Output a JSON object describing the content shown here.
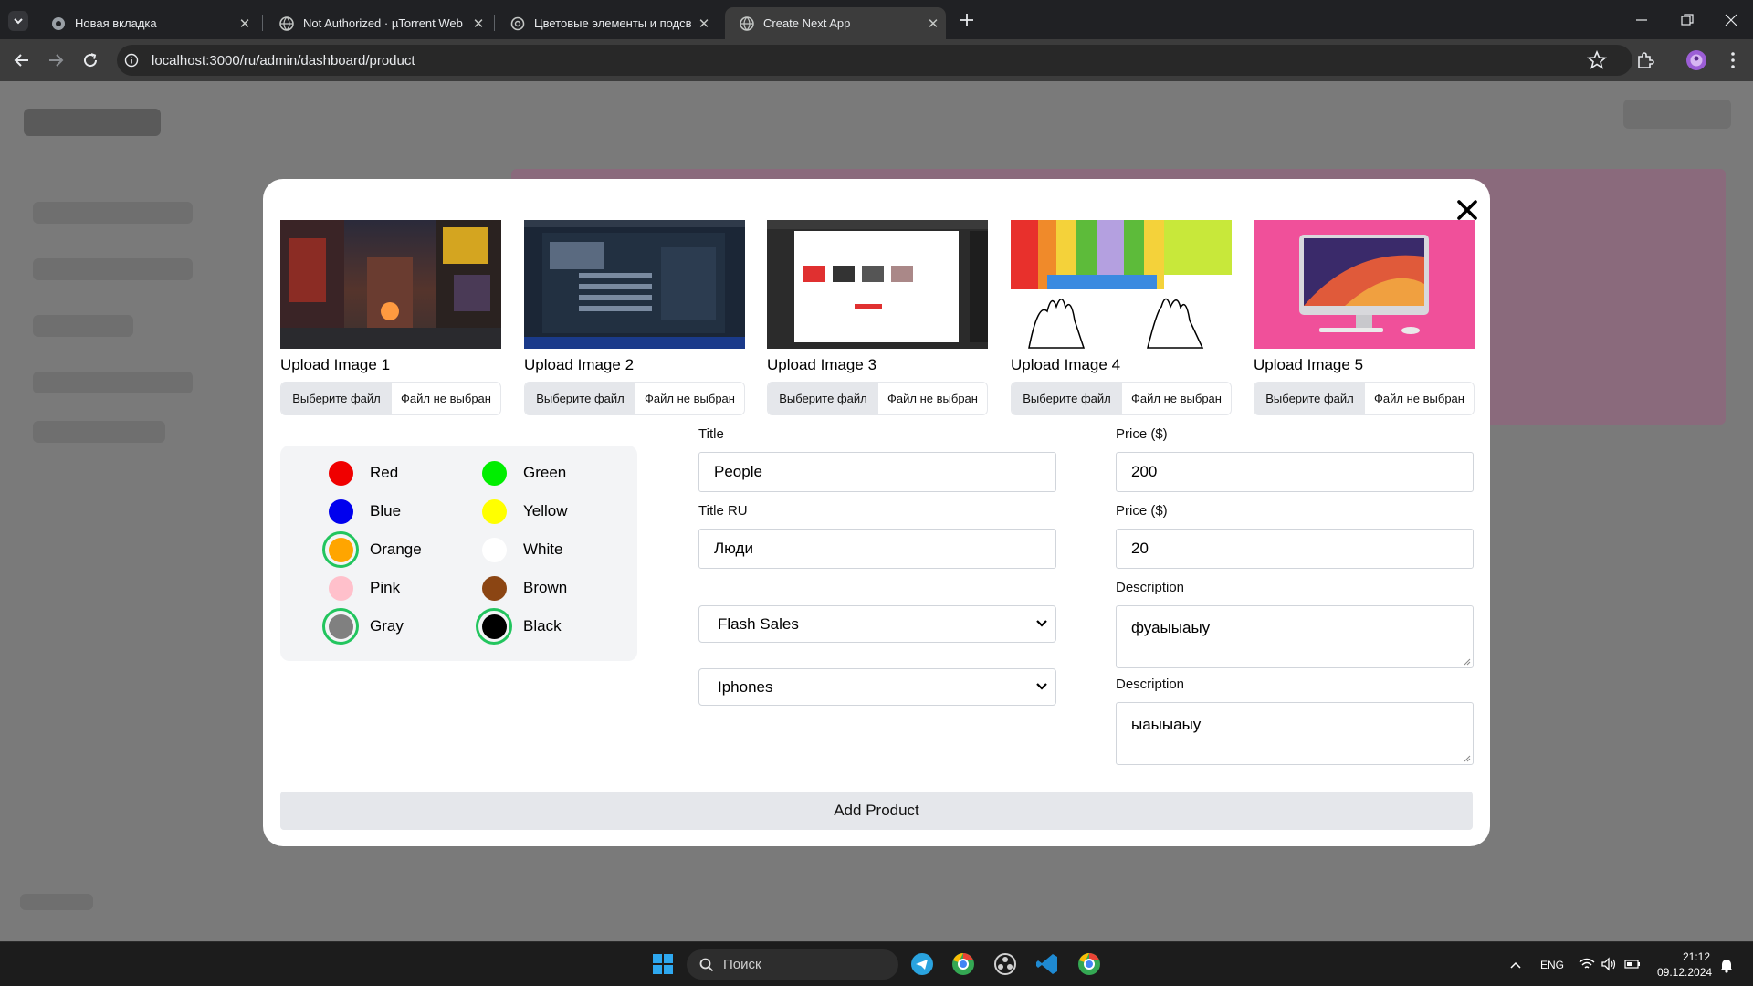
{
  "browser": {
    "tabs": [
      {
        "label": "Новая вкладка",
        "active": false
      },
      {
        "label": "Not Authorized · µTorrent Web",
        "active": false
      },
      {
        "label": "Цветовые элементы и подсвет",
        "active": false
      },
      {
        "label": "Create Next App",
        "active": true
      }
    ],
    "new_tab_icon": "plus-icon",
    "url": "localhost:3000/ru/admin/dashboard/product"
  },
  "modal": {
    "images": [
      {
        "label": "Upload Image 1",
        "button": "Выберите файл",
        "status": "Файл не выбран",
        "thumb": "city-street"
      },
      {
        "label": "Upload Image 2",
        "button": "Выберите файл",
        "status": "Файл не выбран",
        "thumb": "dark-screenshot"
      },
      {
        "label": "Upload Image 3",
        "button": "Выберите файл",
        "status": "Файл не выбран",
        "thumb": "shop-screenshot"
      },
      {
        "label": "Upload Image 4",
        "button": "Выберите файл",
        "status": "Файл не выбран",
        "thumb": "keyboard-fingers"
      },
      {
        "label": "Upload Image 5",
        "button": "Выберите файл",
        "status": "Файл не выбран",
        "thumb": "imac-pink"
      }
    ],
    "colors": [
      {
        "name": "Red",
        "hex": "#f00000",
        "selected": false
      },
      {
        "name": "Green",
        "hex": "#00ee00",
        "selected": false
      },
      {
        "name": "Blue",
        "hex": "#0000ee",
        "selected": false
      },
      {
        "name": "Yellow",
        "hex": "#ffff00",
        "selected": false
      },
      {
        "name": "Orange",
        "hex": "#ffa500",
        "selected": true
      },
      {
        "name": "White",
        "hex": "#ffffff",
        "selected": false
      },
      {
        "name": "Pink",
        "hex": "#ffc0cb",
        "selected": false
      },
      {
        "name": "Brown",
        "hex": "#8b4513",
        "selected": false
      },
      {
        "name": "Gray",
        "hex": "#808080",
        "selected": true
      },
      {
        "name": "Black",
        "hex": "#000000",
        "selected": true
      }
    ],
    "selected_ring_color": "#22c55e",
    "form": {
      "title_label": "Title",
      "title_value": "People",
      "title_ru_label": "Title RU",
      "title_ru_value": "Люди",
      "category_value": "Flash Sales",
      "subcategory_value": "Iphones",
      "price_label": "Price ($)",
      "price_value": "200",
      "price2_label": "Price ($)",
      "price2_value": "20",
      "description_label": "Description",
      "description_value": "фуаыыаыу",
      "description2_label": "Description",
      "description2_value": "ыаыыаыу"
    },
    "submit_label": "Add Product"
  },
  "taskbar": {
    "search_placeholder": "Поиск",
    "language": "ENG",
    "time": "21:12",
    "date": "09.12.2024"
  }
}
